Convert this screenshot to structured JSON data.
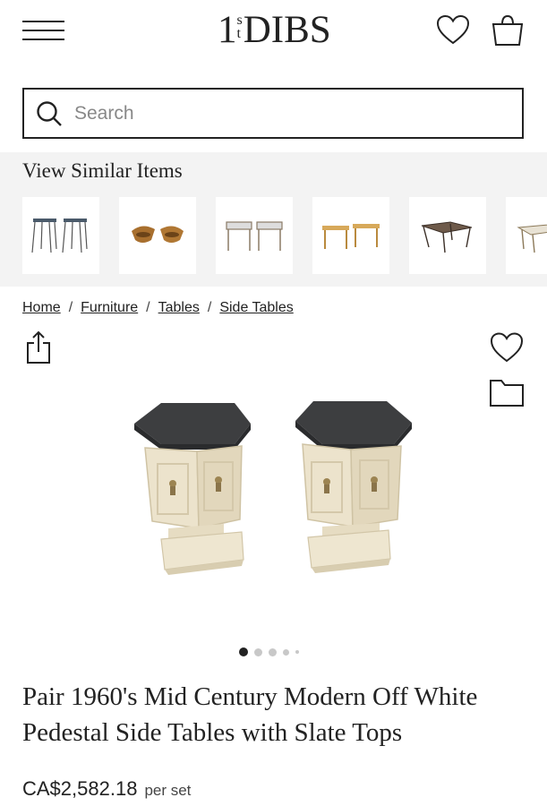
{
  "header": {
    "logo": {
      "number": "1",
      "sup_top": "s",
      "sup_bottom": "t",
      "word": "DIBS"
    },
    "icons": [
      "menu-icon",
      "heart-icon",
      "bag-icon"
    ]
  },
  "search": {
    "placeholder": "Search",
    "value": ""
  },
  "similar": {
    "title": "View Similar Items",
    "items": [
      "hairpin-table-pair",
      "wood-stool-pair",
      "glass-top-table-pair",
      "blonde-wood-table-pair",
      "nesting-tables",
      "brass-side-table"
    ]
  },
  "breadcrumb": {
    "items": [
      "Home",
      "Furniture",
      "Tables",
      "Side Tables"
    ],
    "separator": "/"
  },
  "product": {
    "title": "Pair 1960's Mid Century Modern Off White Pedestal Side Tables with Slate Tops",
    "price": "CA$2,582.18",
    "price_unit": "per set",
    "carousel": {
      "total_dots": 5,
      "active_index": 0
    },
    "colors": {
      "slate": "#3d3e40",
      "cream": "#e9dfc6",
      "brass": "#9c8452"
    }
  },
  "actions": [
    "share-icon",
    "favorite-icon",
    "folder-icon"
  ]
}
